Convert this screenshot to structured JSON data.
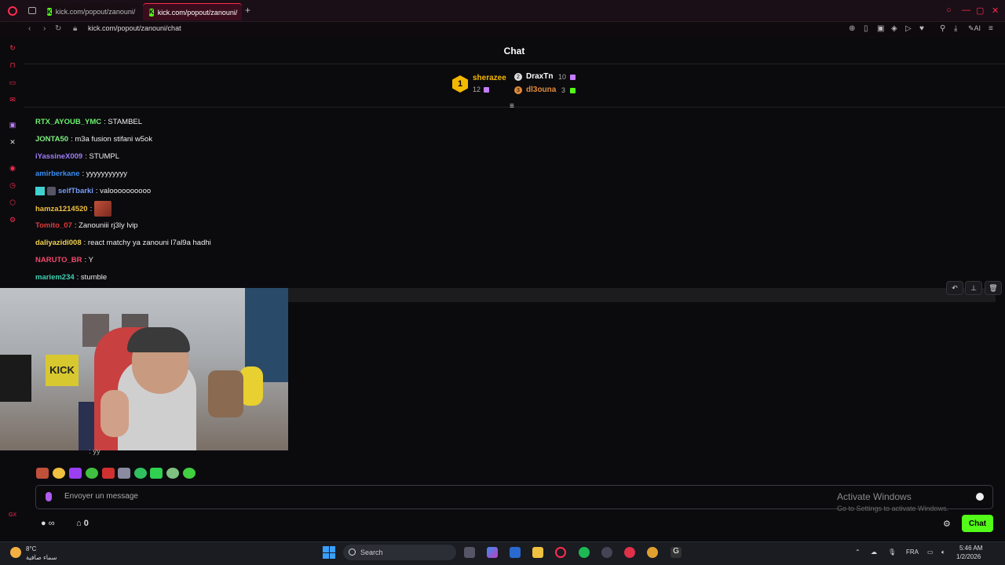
{
  "browser": {
    "tabs": [
      {
        "label": "kick.com/popout/zanouni/"
      },
      {
        "label": "kick.com/popout/zanouni/"
      }
    ],
    "new_tab": "+",
    "url": "kick.com/popout/zanouni/chat"
  },
  "chat": {
    "title": "Chat",
    "leaderboard": {
      "first": {
        "rank": "1",
        "name": "sherazee",
        "count": "12"
      },
      "second": {
        "name": "DraxTn",
        "count": "10"
      },
      "third": {
        "name": "dl3ouna",
        "count": "3"
      }
    },
    "messages": [
      {
        "user": "RTX_AYOUB_YMC",
        "text": ": STAMBEL",
        "color": "#6cf06c"
      },
      {
        "user": "JONTA50",
        "text": ": m3a fusion stifani w5ok",
        "color": "#7ef07e"
      },
      {
        "user": "iYassineX009",
        "text": ": STUMPL",
        "color": "#a07cf6"
      },
      {
        "user": "amirberkane",
        "text": ": yyyyyyyyyyy",
        "color": "#3a8cf0"
      },
      {
        "user": "seifTbarki",
        "text": ": valoooooooooo",
        "color": "#7a9cf6"
      },
      {
        "user": "hamza1214520",
        "text": ":",
        "color": "#f0c040"
      },
      {
        "user": "Tomito_07",
        "text": ": Zanouniii rj3ly lvip",
        "color": "#e03a3a"
      },
      {
        "user": "daliyazidi008",
        "text": ": react matchy ya zanouni l7al9a hadhi",
        "color": "#f0d050"
      },
      {
        "user": "NARUTO_BR",
        "text": ": Y",
        "color": "#f04a6a"
      },
      {
        "user": "mariem234",
        "text": ": stumble",
        "color": "#40d0b0"
      }
    ],
    "partial_message": ": yy",
    "input_placeholder": "Envoyer un message",
    "points_label": "∞",
    "store_count": "0",
    "chat_button": "Chat"
  },
  "windows_notice": {
    "title": "Activate Windows",
    "subtitle": "Go to Settings to activate Windows."
  },
  "taskbar": {
    "weather_temp": "8°C",
    "weather_desc": "سماء صافية",
    "search_label": "Search",
    "language": "FRA",
    "time": "5:46 AM",
    "date": "1/2/2026"
  },
  "colors": {
    "kick_green": "#53fc18",
    "accent_red": "#ff2b4f",
    "gift_purple": "#c57cff"
  }
}
